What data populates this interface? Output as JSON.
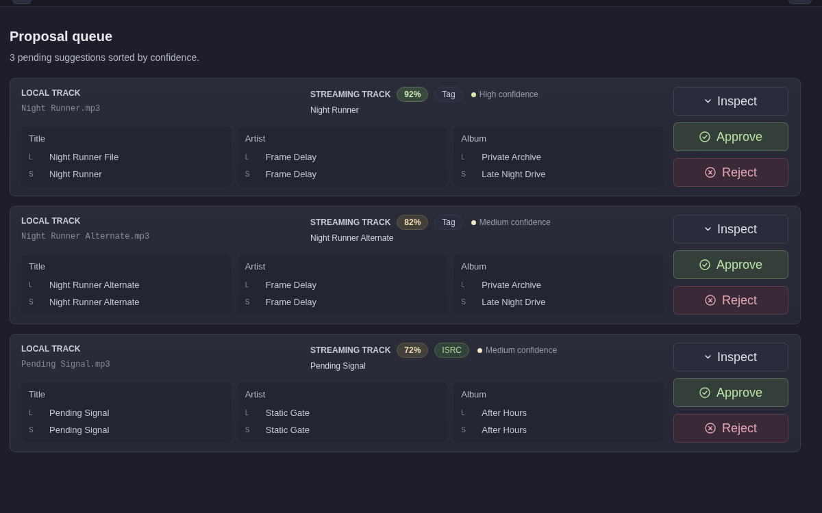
{
  "header": {
    "title": "Proposal queue",
    "subtitle": "3 pending suggestions sorted by confidence."
  },
  "proposals": [
    {
      "kind": "high",
      "local": {
        "label": "LOCAL TRACK",
        "file": "Night Runner.mp3"
      },
      "streaming": {
        "label": "STREAMING TRACK",
        "title": "Night Runner"
      },
      "score": "92%",
      "source": {
        "label": "Tag",
        "kind": "tag"
      },
      "confidence": "High confidence",
      "fields": [
        {
          "name": "Title",
          "rows": [
            {
              "marker": "L",
              "value": "Night Runner File"
            },
            {
              "marker": "S",
              "value": "Night Runner"
            }
          ]
        },
        {
          "name": "Artist",
          "rows": [
            {
              "marker": "L",
              "value": "Frame Delay"
            },
            {
              "marker": "S",
              "value": "Frame Delay"
            }
          ]
        },
        {
          "name": "Album",
          "rows": [
            {
              "marker": "L",
              "value": "Private Archive"
            },
            {
              "marker": "S",
              "value": "Late Night Drive"
            }
          ]
        }
      ],
      "actions": [
        {
          "label": "Inspect",
          "kind": "inspect"
        },
        {
          "label": "Approve",
          "kind": "approve"
        },
        {
          "label": "Reject",
          "kind": "reject"
        }
      ]
    },
    {
      "kind": "medium",
      "local": {
        "label": "LOCAL TRACK",
        "file": "Night Runner Alternate.mp3"
      },
      "streaming": {
        "label": "STREAMING TRACK",
        "title": "Night Runner Alternate"
      },
      "score": "82%",
      "source": {
        "label": "Tag",
        "kind": "tag"
      },
      "confidence": "Medium confidence",
      "fields": [
        {
          "name": "Title",
          "rows": [
            {
              "marker": "L",
              "value": "Night Runner Alternate"
            },
            {
              "marker": "S",
              "value": "Night Runner Alternate"
            }
          ]
        },
        {
          "name": "Artist",
          "rows": [
            {
              "marker": "L",
              "value": "Frame Delay"
            },
            {
              "marker": "S",
              "value": "Frame Delay"
            }
          ]
        },
        {
          "name": "Album",
          "rows": [
            {
              "marker": "L",
              "value": "Private Archive"
            },
            {
              "marker": "S",
              "value": "Late Night Drive"
            }
          ]
        }
      ],
      "actions": [
        {
          "label": "Inspect",
          "kind": "inspect"
        },
        {
          "label": "Approve",
          "kind": "approve"
        },
        {
          "label": "Reject",
          "kind": "reject"
        }
      ]
    },
    {
      "kind": "medium",
      "local": {
        "label": "LOCAL TRACK",
        "file": "Pending Signal.mp3"
      },
      "streaming": {
        "label": "STREAMING TRACK",
        "title": "Pending Signal"
      },
      "score": "72%",
      "source": {
        "label": "ISRC",
        "kind": "isrc"
      },
      "confidence": "Medium confidence",
      "fields": [
        {
          "name": "Title",
          "rows": [
            {
              "marker": "L",
              "value": "Pending Signal"
            },
            {
              "marker": "S",
              "value": "Pending Signal"
            }
          ]
        },
        {
          "name": "Artist",
          "rows": [
            {
              "marker": "L",
              "value": "Static Gate"
            },
            {
              "marker": "S",
              "value": "Static Gate"
            }
          ]
        },
        {
          "name": "Album",
          "rows": [
            {
              "marker": "L",
              "value": "After Hours"
            },
            {
              "marker": "S",
              "value": "After Hours"
            }
          ]
        }
      ],
      "actions": [
        {
          "label": "Inspect",
          "kind": "inspect"
        },
        {
          "label": "Approve",
          "kind": "approve"
        },
        {
          "label": "Reject",
          "kind": "reject"
        }
      ]
    }
  ]
}
